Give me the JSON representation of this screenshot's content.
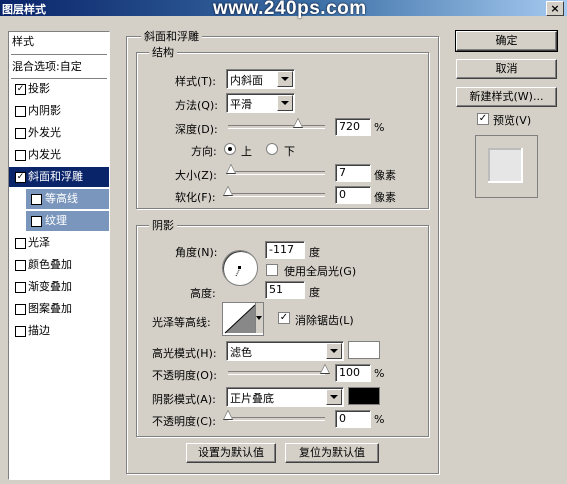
{
  "window": {
    "title": "图层样式",
    "watermark": "www.240ps.com",
    "close_glyph": "×"
  },
  "styles_list": {
    "header": "样式",
    "blend": "混合选项:自定",
    "items": [
      {
        "label": "投影",
        "checked": true
      },
      {
        "label": "内阴影",
        "checked": false
      },
      {
        "label": "外发光",
        "checked": false
      },
      {
        "label": "内发光",
        "checked": false
      },
      {
        "label": "斜面和浮雕",
        "checked": true,
        "selected": true
      },
      {
        "label": "等高线",
        "checked": false,
        "sub": true
      },
      {
        "label": "纹理",
        "checked": false,
        "sub": true
      },
      {
        "label": "光泽",
        "checked": false
      },
      {
        "label": "颜色叠加",
        "checked": false
      },
      {
        "label": "渐变叠加",
        "checked": false
      },
      {
        "label": "图案叠加",
        "checked": false
      },
      {
        "label": "描边",
        "checked": false
      }
    ],
    "check_glyph": "✓"
  },
  "bevel": {
    "group_title": "斜面和浮雕",
    "structure_title": "结构",
    "style_label": "样式(T):",
    "style_value": "内斜面",
    "technique_label": "方法(Q):",
    "technique_value": "平滑",
    "depth_label": "深度(D):",
    "depth_value": "720",
    "depth_unit": "%",
    "depth_fraction": 0.72,
    "direction_label": "方向:",
    "dir_up": "上",
    "dir_down": "下",
    "size_label": "大小(Z):",
    "size_value": "7",
    "size_unit": "像素",
    "size_fraction": 0.03,
    "soften_label": "软化(F):",
    "soften_value": "0",
    "soften_unit": "像素",
    "soften_fraction": 0.0
  },
  "shading": {
    "title": "阴影",
    "angle_label": "角度(N):",
    "angle_value": "-117",
    "angle_unit": "度",
    "global_light_label": "使用全局光(G)",
    "altitude_label": "高度:",
    "altitude_value": "51",
    "altitude_unit": "度",
    "gloss_label": "光泽等高线:",
    "antialias_label": "消除锯齿(L)",
    "highlight_label": "高光模式(H):",
    "highlight_mode": "滤色",
    "highlight_color": "#ffffff",
    "h_opacity_label": "不透明度(O):",
    "h_opacity_value": "100",
    "h_opacity_unit": "%",
    "h_opacity_fraction": 1.0,
    "shadow_label": "阴影模式(A):",
    "shadow_mode": "正片叠底",
    "shadow_color": "#000000",
    "s_opacity_label": "不透明度(C):",
    "s_opacity_value": "0",
    "s_opacity_unit": "%",
    "s_opacity_fraction": 0.0
  },
  "buttons": {
    "make_default": "设置为默认值",
    "reset_default": "复位为默认值",
    "ok": "确定",
    "cancel": "取消",
    "new_style": "新建样式(W)...",
    "preview": "预览(V)"
  }
}
